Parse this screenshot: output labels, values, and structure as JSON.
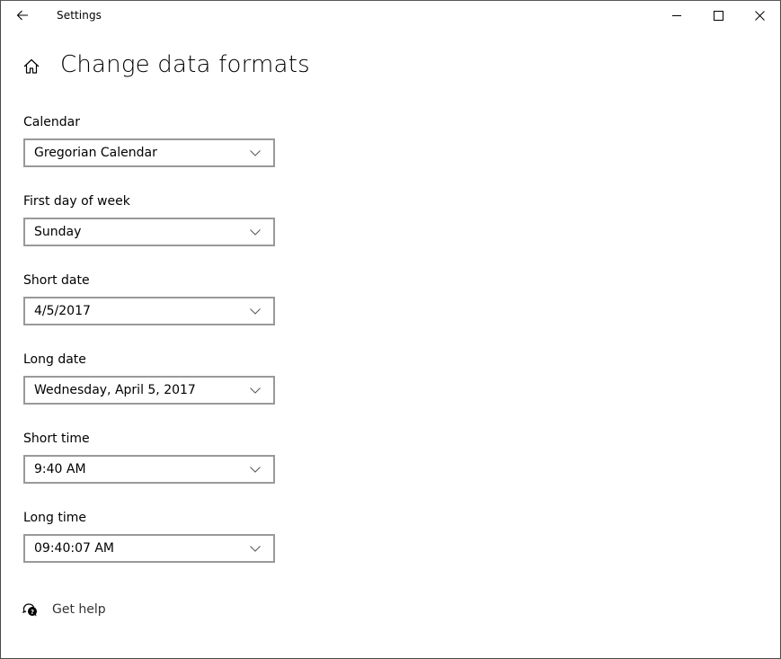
{
  "window": {
    "title": "Settings",
    "controls": {
      "minimize": "minimize-icon",
      "maximize": "maximize-icon",
      "close": "close-icon"
    }
  },
  "nav": {
    "back_icon": "back-arrow-icon",
    "home_icon": "home-icon"
  },
  "page": {
    "title": "Change data formats"
  },
  "fields": [
    {
      "label": "Calendar",
      "value": "Gregorian Calendar"
    },
    {
      "label": "First day of week",
      "value": "Sunday"
    },
    {
      "label": "Short date",
      "value": "4/5/2017"
    },
    {
      "label": "Long date",
      "value": "Wednesday, April 5, 2017"
    },
    {
      "label": "Short time",
      "value": "9:40 AM"
    },
    {
      "label": "Long time",
      "value": "09:40:07 AM"
    }
  ],
  "help": {
    "label": "Get help",
    "icon": "help-chat-icon"
  }
}
